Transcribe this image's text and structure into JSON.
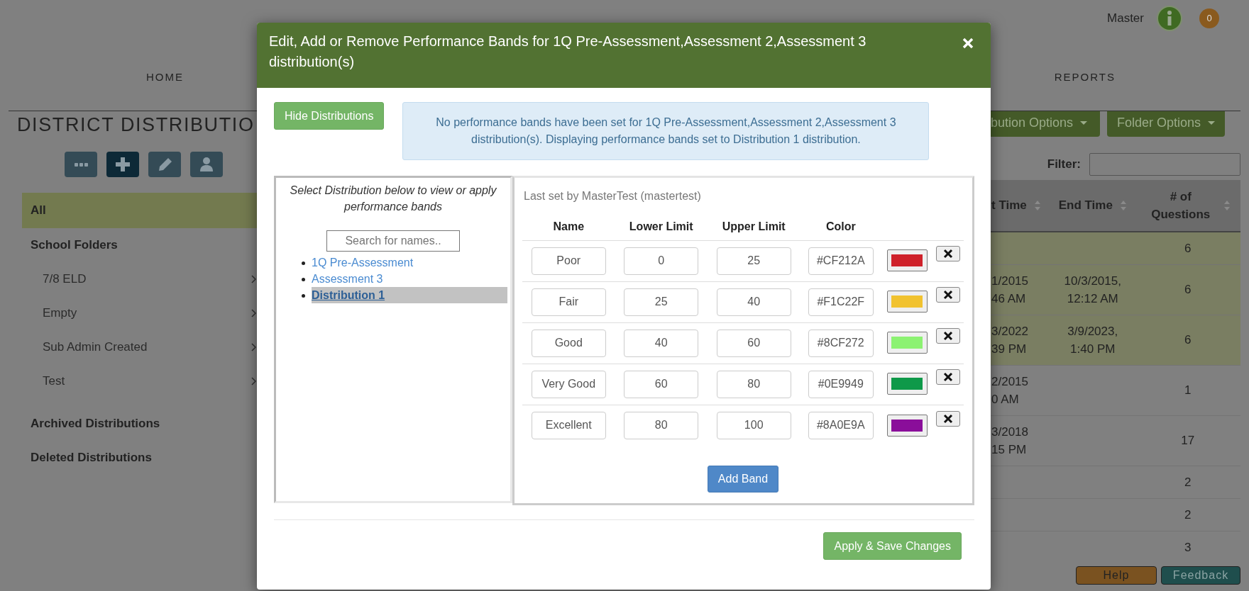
{
  "header": {
    "user": "Master",
    "notification_count": "0"
  },
  "nav": [
    {
      "label": "HOME"
    },
    {
      "label": "REPORTS"
    }
  ],
  "page_title": "DISTRICT DISTRIBUTIO",
  "toolbar": [
    {
      "kind": "more",
      "selected": false
    },
    {
      "kind": "add",
      "selected": true
    },
    {
      "kind": "edit",
      "selected": false
    },
    {
      "kind": "user",
      "selected": false
    }
  ],
  "sidebar": [
    {
      "label": "All",
      "selected": true
    },
    {
      "label": "School Folders",
      "selected": false,
      "children": [
        {
          "label": "7/8 ELD",
          "selected": false
        },
        {
          "label": "Empty",
          "selected": false
        },
        {
          "label": "Sub Admin Created",
          "selected": false
        },
        {
          "label": "Test",
          "selected": false
        }
      ]
    },
    {
      "label": "Archived Distributions",
      "selected": false
    },
    {
      "label": "Deleted Distributions",
      "selected": false
    }
  ],
  "option_buttons": [
    {
      "label": "bution Options"
    },
    {
      "label": "Folder Options"
    }
  ],
  "filter": {
    "label": "Filter:"
  },
  "table": {
    "columns": [
      "t Time",
      "End Time",
      "# of Questions"
    ],
    "rows": [
      {
        "highlighted": true,
        "cells": [
          "",
          "",
          "6"
        ]
      },
      {
        "highlighted": true,
        "cells": [
          "1/2015\n46 AM",
          "10/3/2015,\n12:12 AM",
          "6"
        ]
      },
      {
        "highlighted": true,
        "cells": [
          "3/2022\n39 PM",
          "3/9/2023,\n1:40 PM",
          "6"
        ]
      },
      {
        "highlighted": false,
        "cells": [
          "2/2015\n0 AM",
          "",
          "1"
        ]
      },
      {
        "highlighted": false,
        "cells": [
          "3/2018\n15 PM",
          "",
          "17"
        ]
      },
      {
        "highlighted": false,
        "cells": [
          "",
          "",
          "2"
        ]
      },
      {
        "highlighted": false,
        "cells": [
          "",
          "",
          "2"
        ]
      },
      {
        "highlighted": false,
        "cells": [
          "",
          "",
          "3"
        ]
      }
    ]
  },
  "footer_buttons": [
    {
      "label": "Help",
      "kind": "help"
    },
    {
      "label": "Feedback",
      "kind": "feedback"
    }
  ],
  "modal": {
    "title": "Edit, Add or Remove Performance Bands for 1Q Pre-Assessment,Assessment 2,Assessment 3 distribution(s)",
    "hide_button": "Hide Distributions",
    "notice": "No performance bands have been set for 1Q Pre-Assessment,Assessment 2,Assessment 3 distribution(s). Displaying performance bands set to Distribution 1 distribution.",
    "distribution_panel": {
      "instructions": "Select Distribution below to view or apply performance bands",
      "search": {
        "placeholder": "Search for names.."
      },
      "items": [
        {
          "label": "1Q Pre-Assessment",
          "selected": false
        },
        {
          "label": "Assessment 3",
          "selected": false
        },
        {
          "label": "Distribution 1",
          "selected": true
        }
      ]
    },
    "bands_panel": {
      "last_set": "Last set by MasterTest (mastertest)",
      "columns": [
        "Name",
        "Lower Limit",
        "Upper Limit",
        "Color"
      ],
      "bands": [
        {
          "name": "Poor",
          "lower": "0",
          "upper": "25",
          "hex": "#CF212A",
          "color": "#cf212a"
        },
        {
          "name": "Fair",
          "lower": "25",
          "upper": "40",
          "hex": "#F1C22F",
          "color": "#f1c22f"
        },
        {
          "name": "Good",
          "lower": "40",
          "upper": "60",
          "hex": "#8CF272",
          "color": "#8cf272"
        },
        {
          "name": "Very Good",
          "lower": "60",
          "upper": "80",
          "hex": "#0E9949",
          "color": "#0e9949"
        },
        {
          "name": "Excellent",
          "lower": "80",
          "upper": "100",
          "hex": "#8A0E9A",
          "color": "#8a0e9a"
        }
      ],
      "add_button": "Add Band"
    },
    "save_button": "Apply & Save Changes"
  }
}
